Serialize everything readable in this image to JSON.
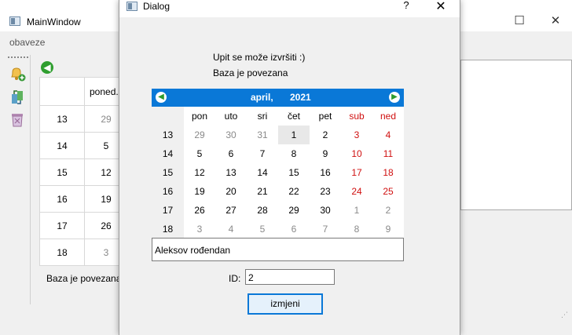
{
  "main_window": {
    "title": "MainWindow",
    "minimize_glyph": "—",
    "maximize_glyph": "☐",
    "close_glyph": "✕",
    "menu": [
      "obaveze"
    ],
    "toolbar": [
      "bell-add-icon",
      "edit-arrows-icon",
      "trash-icon"
    ],
    "back_glyph": "◀",
    "table": {
      "header": "poned...",
      "rows": [
        {
          "week": "13",
          "day": "29",
          "faded": true
        },
        {
          "week": "14",
          "day": "5",
          "faded": false
        },
        {
          "week": "15",
          "day": "12",
          "faded": false
        },
        {
          "week": "16",
          "day": "19",
          "faded": false
        },
        {
          "week": "17",
          "day": "26",
          "faded": false
        },
        {
          "week": "18",
          "day": "3",
          "faded": true
        }
      ]
    },
    "status": "Baza je povezana",
    "resize_grip": "⋰"
  },
  "dialog": {
    "title": "Dialog",
    "help": "?",
    "close": "✕",
    "message_line1": "Upit se može izvršiti :)",
    "message_line2": "Baza je povezana",
    "calendar": {
      "month": "april,",
      "year": "2021",
      "prev_glyph": "◀",
      "next_glyph": "▶",
      "weekday_headers": [
        "pon",
        "uto",
        "sri",
        "čet",
        "pet",
        "sub",
        "ned"
      ],
      "weeks": [
        {
          "num": "13",
          "days": [
            "29",
            "30",
            "31",
            "1",
            "2",
            "3",
            "4"
          ]
        },
        {
          "num": "14",
          "days": [
            "5",
            "6",
            "7",
            "8",
            "9",
            "10",
            "11"
          ]
        },
        {
          "num": "15",
          "days": [
            "12",
            "13",
            "14",
            "15",
            "16",
            "17",
            "18"
          ]
        },
        {
          "num": "16",
          "days": [
            "19",
            "20",
            "21",
            "22",
            "23",
            "24",
            "25"
          ]
        },
        {
          "num": "17",
          "days": [
            "26",
            "27",
            "28",
            "29",
            "30",
            "1",
            "2"
          ]
        },
        {
          "num": "18",
          "days": [
            "3",
            "4",
            "5",
            "6",
            "7",
            "8",
            "9"
          ]
        }
      ],
      "selected_date": "1",
      "weekend_color": "#d01010",
      "nav_color": "#0a78d7"
    },
    "note_value": "Aleksov rođendan",
    "id_label": "ID:",
    "id_value": "2",
    "submit_label": "izmjeni"
  }
}
